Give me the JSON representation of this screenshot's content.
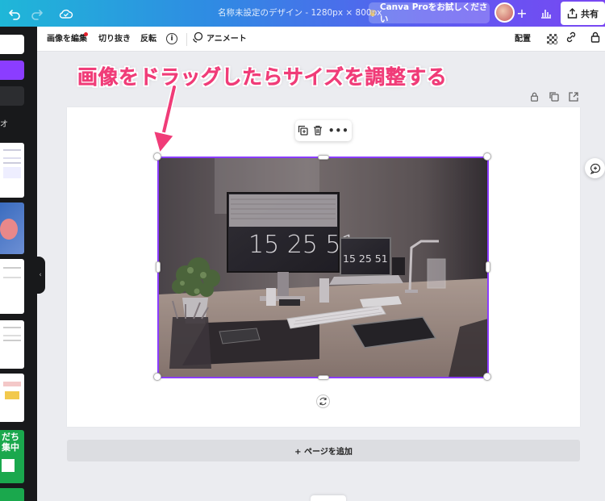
{
  "topbar": {
    "doc_title": "名称未設定のデザイン - 1280px × 800px",
    "pro_label": "Canva Proをお試しください",
    "share_label": "共有"
  },
  "toolbar": {
    "edit_image": "画像を編集",
    "crop": "切り抜き",
    "flip": "反転",
    "animate": "アニメート",
    "position": "配置"
  },
  "annotation": "画像をドラッグしたらサイズを調整する",
  "photo": {
    "monitor_clock": "15 25 51",
    "laptop_clock": "15 25 51"
  },
  "add_page_label": "+ ページを追加",
  "sidebar": {
    "thumb_text_1": "オ",
    "thumb_text_2": "だち",
    "thumb_text_3": "集中"
  },
  "colors": {
    "selection": "#8b3dff",
    "annotation": "#f03c78",
    "sidebar": "#18191b"
  }
}
